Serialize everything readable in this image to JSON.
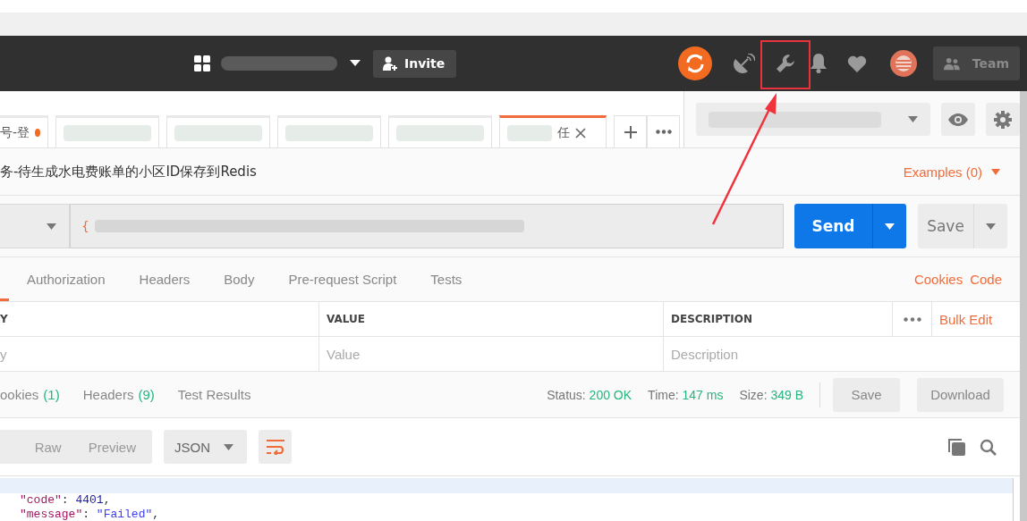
{
  "header": {
    "invite": "Invite",
    "team": "Team"
  },
  "request_tabs": [
    {
      "label": "号-登",
      "unsaved": true,
      "selected": false
    },
    {
      "unsaved": false,
      "selected": false
    },
    {
      "unsaved": false,
      "selected": false
    },
    {
      "unsaved": false,
      "selected": false
    },
    {
      "unsaved": false,
      "selected": false
    },
    {
      "label": "任",
      "unsaved": false,
      "selected": true
    }
  ],
  "request": {
    "title": "务-待生成水电费账单的小区ID保存到Redis",
    "examples": "Examples (0)",
    "url_start": "{",
    "send": "Send",
    "save": "Save"
  },
  "request_sections": [
    {
      "selected": true
    },
    {
      "label": "Authorization",
      "selected": false
    },
    {
      "label": "Headers",
      "selected": false
    },
    {
      "label": "Body",
      "selected": false
    },
    {
      "label": "Pre-request Script",
      "selected": false
    },
    {
      "label": "Tests",
      "selected": false
    }
  ],
  "request_links": [
    "Cookies",
    "Code"
  ],
  "params_table": {
    "columns": [
      "Y",
      "VALUE",
      "DESCRIPTION"
    ],
    "bulk_edit": "Bulk Edit",
    "placeholders": [
      "y",
      "Value",
      "Description"
    ]
  },
  "response_tabs": [
    {
      "label": "ookies",
      "count": "(1)",
      "selected": false
    },
    {
      "label": "Headers",
      "count": "(9)",
      "selected": false
    },
    {
      "label": "Test Results",
      "selected": false
    }
  ],
  "response_status": [
    {
      "label": "Status:",
      "value": "200 OK"
    },
    {
      "label": "Time:",
      "value": "147 ms"
    },
    {
      "label": "Size:",
      "value": "349 B"
    }
  ],
  "response_buttons": [
    "Save",
    "Download"
  ],
  "view_modes": [
    {
      "label": "Raw",
      "selected": false
    },
    {
      "label": "Preview",
      "selected": false
    }
  ],
  "format": "JSON",
  "code_lines": [
    {
      "active": true
    },
    {
      "active": false,
      "tokens": [
        {
          "kind": "key",
          "text": "\"code\""
        },
        {
          "kind": "punct",
          "text": ": "
        },
        {
          "kind": "number",
          "text": "4401"
        },
        {
          "kind": "punct",
          "text": ","
        }
      ]
    },
    {
      "active": false,
      "tokens": [
        {
          "kind": "key",
          "text": "\"message\""
        },
        {
          "kind": "punct",
          "text": ": "
        },
        {
          "kind": "string",
          "text": "\"Failed\""
        },
        {
          "kind": "punct",
          "text": ","
        }
      ]
    }
  ]
}
